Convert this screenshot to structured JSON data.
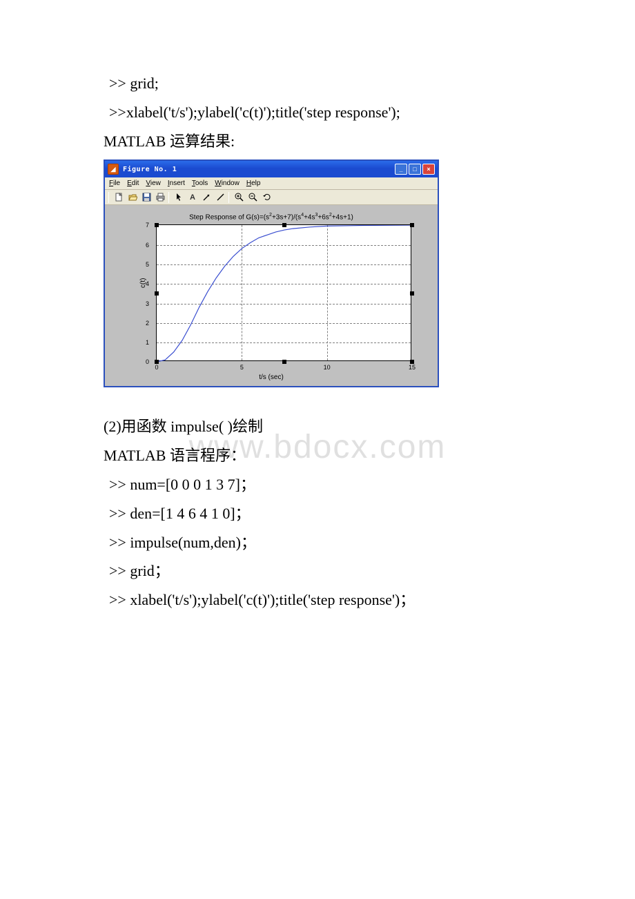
{
  "doc": {
    "line1": ">> grid;",
    "line2": ">>xlabel('t/s');ylabel('c(t)');title('step response');",
    "line3": "MATLAB 运算结果:",
    "line4": "(2)用函数 impulse( )绘制",
    "line5": "MATLAB 语言程序：",
    "line6": ">> num=[0 0 0 1 3 7]；",
    "line7": ">> den=[1 4 6 4 1 0]；",
    "line8": " >> impulse(num,den)；",
    "line9": ">> grid；",
    "line10": ">> xlabel('t/s');ylabel('c(t)');title('step response')；"
  },
  "figure": {
    "title": "Figure No. 1",
    "menu": {
      "file": "File",
      "edit": "Edit",
      "view": "View",
      "insert": "Insert",
      "tools": "Tools",
      "window": "Window",
      "help": "Help"
    },
    "plot_title_prefix": "Step Response of G(s)=(s",
    "plot_title_mid1": "+3s+7)/(s",
    "plot_title_mid2": "+4s",
    "plot_title_mid3": "+6s",
    "plot_title_suffix": "+4s+1)",
    "sup2": "2",
    "sup3": "3",
    "sup4": "4",
    "ylabel": "c(t)",
    "xlabel": "t/s (sec)"
  },
  "watermark": "www.bdocx.com",
  "chart_data": {
    "type": "line",
    "title": "Step Response of G(s)=(s^2+3s+7)/(s^4+4s^3+6s^2+4s+1)",
    "xlabel": "t/s (sec)",
    "ylabel": "c(t)",
    "x": [
      0,
      0.5,
      1,
      1.5,
      2,
      2.5,
      3,
      3.5,
      4,
      4.5,
      5,
      5.5,
      6,
      6.5,
      7,
      7.5,
      8,
      9,
      10,
      12,
      15
    ],
    "y": [
      0,
      0.1,
      0.5,
      1.1,
      1.9,
      2.8,
      3.6,
      4.3,
      4.9,
      5.4,
      5.8,
      6.1,
      6.35,
      6.5,
      6.65,
      6.75,
      6.82,
      6.9,
      6.95,
      6.98,
      7.0
    ],
    "x_ticks": [
      0,
      5,
      10,
      15
    ],
    "y_ticks": [
      0,
      1,
      2,
      3,
      4,
      5,
      6,
      7
    ],
    "xlim": [
      0,
      15
    ],
    "ylim": [
      0,
      7
    ],
    "grid": true
  }
}
